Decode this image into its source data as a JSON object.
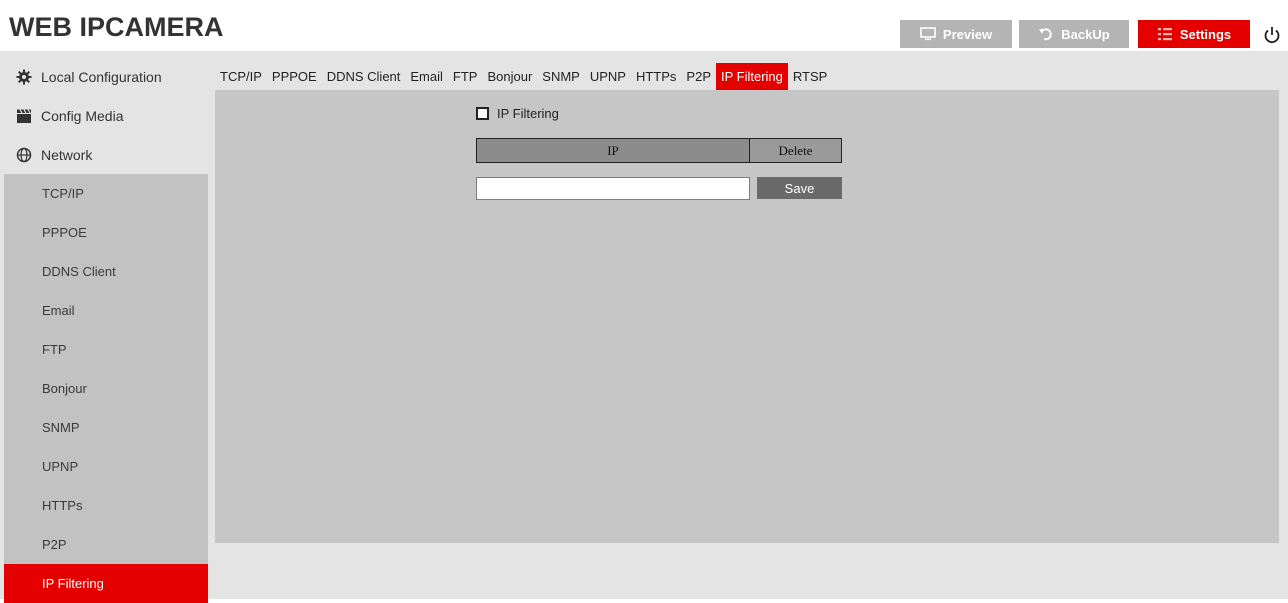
{
  "header": {
    "title": "WEB IPCAMERA",
    "buttons": {
      "preview": "Preview",
      "backup": "BackUp",
      "settings": "Settings"
    },
    "icons": {
      "preview": "monitor-icon",
      "backup": "undo-icon",
      "settings": "list-icon",
      "power": "power-icon"
    }
  },
  "sidebar": {
    "sections": [
      {
        "label": "Local Configuration",
        "icon": "gear-icon"
      },
      {
        "label": "Config Media",
        "icon": "clapperboard-icon"
      },
      {
        "label": "Network",
        "icon": "globe-icon"
      }
    ],
    "subitems": [
      "TCP/IP",
      "PPPOE",
      "DDNS Client",
      "Email",
      "FTP",
      "Bonjour",
      "SNMP",
      "UPNP",
      "HTTPs",
      "P2P",
      "IP Filtering"
    ],
    "active_subitem": "IP Filtering"
  },
  "tabs": {
    "items": [
      "TCP/IP",
      "PPPOE",
      "DDNS Client",
      "Email",
      "FTP",
      "Bonjour",
      "SNMP",
      "UPNP",
      "HTTPs",
      "P2P",
      "IP Filtering",
      "RTSP"
    ],
    "active": "IP Filtering"
  },
  "ip_filtering": {
    "checkbox_label": "IP Filtering",
    "checked": false,
    "table_headers": {
      "ip": "IP",
      "delete": "Delete"
    },
    "input_value": "",
    "save_label": "Save"
  },
  "colors": {
    "accent": "#e50000",
    "button_gray": "#b4b4b4",
    "frame": "#e4e4e4",
    "panel": "#c6c6c6",
    "save_button": "#6a6a6a"
  }
}
